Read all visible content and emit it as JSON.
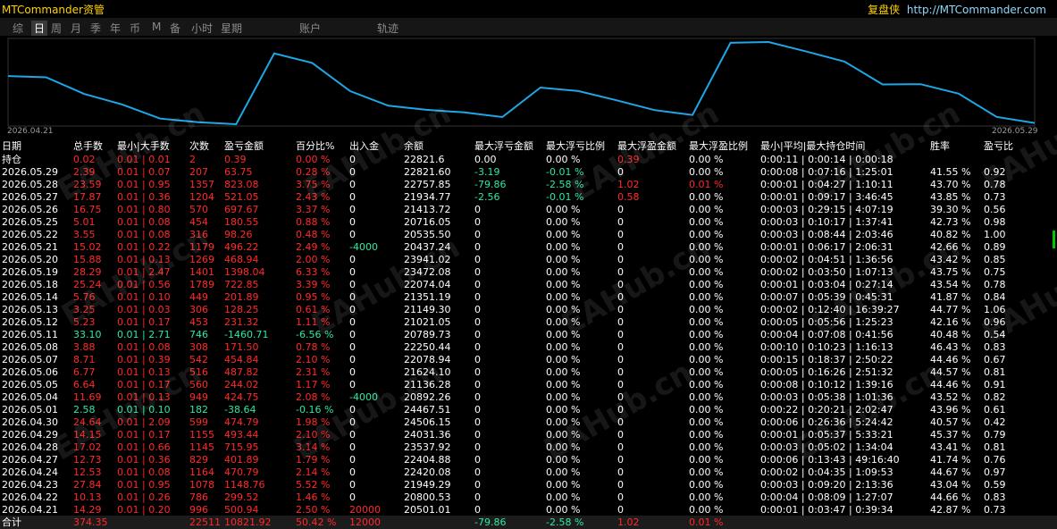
{
  "app": {
    "title": "MTCommander资管",
    "brand_cn": "复盘侠",
    "brand_url": "http://MTCommander.com"
  },
  "tabs": [
    "综",
    "日",
    "周",
    "月",
    "季",
    "年",
    "币",
    "M",
    "备",
    "小时",
    "星期",
    "账户",
    "轨迹"
  ],
  "active_tab": "日",
  "chart_data": {
    "type": "line",
    "x_start_label": "2026.04.21",
    "x_end_label": "2026.05.29",
    "line_color": "#1ea7e6",
    "x": [
      "2026.04.21",
      "2026.04.22",
      "2026.04.23",
      "2026.04.24",
      "2026.04.27",
      "2026.04.28",
      "2026.04.29",
      "2026.04.30",
      "2026.05.01",
      "2026.05.04",
      "2026.05.05",
      "2026.05.06",
      "2026.05.07",
      "2026.05.08",
      "2026.05.11",
      "2026.05.12",
      "2026.05.13",
      "2026.05.14",
      "2026.05.18",
      "2026.05.19",
      "2026.05.20",
      "2026.05.21",
      "2026.05.22",
      "2026.05.25",
      "2026.05.26",
      "2026.05.27",
      "2026.05.28",
      "2026.05.29"
    ],
    "values": [
      20501.01,
      20800.53,
      21949.29,
      22420.08,
      22404.88,
      23537.92,
      24031.36,
      24506.15,
      24467.51,
      20892.26,
      21136.28,
      21624.1,
      22078.94,
      22250.44,
      20789.73,
      21021.05,
      21149.3,
      21351.19,
      22074.04,
      23472.08,
      23941.02,
      20437.24,
      20535.5,
      20716.05,
      21413.72,
      21934.77,
      22757.85,
      22821.6
    ]
  },
  "columns": [
    "日期",
    "总手数",
    "最小|大手数",
    "次数",
    "盈亏金额",
    "百分比%",
    "出入金",
    "余额",
    "最大浮亏金额",
    "最大浮亏比例",
    "最大浮盈金额",
    "最大浮盈比例",
    "最小|平均|最大持仓时间",
    "胜率",
    "盈亏比"
  ],
  "position_row": {
    "date": "持仓",
    "lots": "0.02",
    "minmax": "0.01 | 0.01",
    "count": "2",
    "pnl": "0.39",
    "pct": "0.00 %",
    "flow": "0",
    "balance": "22821.6",
    "max_fl": "0.00",
    "max_flp": "0.00 %",
    "max_fp": "0.39",
    "max_fpp": "0.00 %",
    "hold": "0:00:11 | 0:00:14 | 0:00:18",
    "win": "",
    "ratio": ""
  },
  "rows": [
    {
      "date": "2026.05.29",
      "lots": "2.39",
      "minmax": "0.01 | 0.07",
      "count": "207",
      "pnl": "63.75",
      "pct": "0.28 %",
      "flow": "0",
      "balance": "22821.60",
      "max_fl": "-3.19",
      "max_flp": "-0.01 %",
      "max_fp": "0",
      "max_fpp": "0.00 %",
      "hold": "0:00:08 | 0:07:16 | 1:25:01",
      "win": "41.55 %",
      "ratio": "0.92",
      "c": "red"
    },
    {
      "date": "2026.05.28",
      "lots": "23.59",
      "minmax": "0.01 | 0.95",
      "count": "1357",
      "pnl": "823.08",
      "pct": "3.75 %",
      "flow": "0",
      "balance": "22757.85",
      "max_fl": "-79.86",
      "max_flp": "-2.58 %",
      "max_fp": "1.02",
      "max_fpp": "0.01 %",
      "hold": "0:00:01 | 0:04:27 | 1:10:11",
      "win": "43.70 %",
      "ratio": "0.78",
      "c": "red"
    },
    {
      "date": "2026.05.27",
      "lots": "17.87",
      "minmax": "0.01 | 0.36",
      "count": "1204",
      "pnl": "521.05",
      "pct": "2.43 %",
      "flow": "0",
      "balance": "21934.77",
      "max_fl": "-2.56",
      "max_flp": "-0.01 %",
      "max_fp": "0.58",
      "max_fpp": "0.00 %",
      "hold": "0:00:01 | 0:09:17 | 3:46:45",
      "win": "43.85 %",
      "ratio": "0.73",
      "c": "red"
    },
    {
      "date": "2026.05.26",
      "lots": "16.75",
      "minmax": "0.01 | 0.80",
      "count": "570",
      "pnl": "697.67",
      "pct": "3.37 %",
      "flow": "0",
      "balance": "21413.72",
      "max_fl": "0",
      "max_flp": "0.00 %",
      "max_fp": "0",
      "max_fpp": "0.00 %",
      "hold": "0:00:03 | 0:29:15 | 4:07:19",
      "win": "39.30 %",
      "ratio": "0.56",
      "c": "red"
    },
    {
      "date": "2026.05.25",
      "lots": "5.01",
      "minmax": "0.01 | 0.08",
      "count": "454",
      "pnl": "180.55",
      "pct": "0.88 %",
      "flow": "0",
      "balance": "20716.05",
      "max_fl": "0",
      "max_flp": "0.00 %",
      "max_fp": "0",
      "max_fpp": "0.00 %",
      "hold": "0:00:03 | 0:10:17 | 1:37:41",
      "win": "42.73 %",
      "ratio": "0.98",
      "c": "red"
    },
    {
      "date": "2026.05.22",
      "lots": "3.55",
      "minmax": "0.01 | 0.08",
      "count": "316",
      "pnl": "98.26",
      "pct": "0.48 %",
      "flow": "0",
      "balance": "20535.50",
      "max_fl": "0",
      "max_flp": "0.00 %",
      "max_fp": "0",
      "max_fpp": "0.00 %",
      "hold": "0:00:03 | 0:08:44 | 2:03:46",
      "win": "40.82 %",
      "ratio": "1.00",
      "c": "red"
    },
    {
      "date": "2026.05.21",
      "lots": "15.02",
      "minmax": "0.01 | 0.22",
      "count": "1179",
      "pnl": "496.22",
      "pct": "2.49 %",
      "flow": "-4000",
      "balance": "20437.24",
      "max_fl": "0",
      "max_flp": "0.00 %",
      "max_fp": "0",
      "max_fpp": "0.00 %",
      "hold": "0:00:01 | 0:06:17 | 2:06:31",
      "win": "42.66 %",
      "ratio": "0.89",
      "c": "red"
    },
    {
      "date": "2026.05.20",
      "lots": "15.88",
      "minmax": "0.01 | 0.13",
      "count": "1269",
      "pnl": "468.94",
      "pct": "2.00 %",
      "flow": "0",
      "balance": "23941.02",
      "max_fl": "0",
      "max_flp": "0.00 %",
      "max_fp": "0",
      "max_fpp": "0.00 %",
      "hold": "0:00:02 | 0:04:51 | 1:36:56",
      "win": "43.42 %",
      "ratio": "0.85",
      "c": "red"
    },
    {
      "date": "2026.05.19",
      "lots": "28.29",
      "minmax": "0.01 | 2.47",
      "count": "1401",
      "pnl": "1398.04",
      "pct": "6.33 %",
      "flow": "0",
      "balance": "23472.08",
      "max_fl": "0",
      "max_flp": "0.00 %",
      "max_fp": "0",
      "max_fpp": "0.00 %",
      "hold": "0:00:02 | 0:03:50 | 1:07:13",
      "win": "43.75 %",
      "ratio": "0.75",
      "c": "red"
    },
    {
      "date": "2026.05.18",
      "lots": "25.24",
      "minmax": "0.01 | 0.56",
      "count": "1789",
      "pnl": "722.85",
      "pct": "3.39 %",
      "flow": "0",
      "balance": "22074.04",
      "max_fl": "0",
      "max_flp": "0.00 %",
      "max_fp": "0",
      "max_fpp": "0.00 %",
      "hold": "0:00:01 | 0:03:04 | 0:27:14",
      "win": "43.54 %",
      "ratio": "0.78",
      "c": "red"
    },
    {
      "date": "2026.05.14",
      "lots": "5.76",
      "minmax": "0.01 | 0.10",
      "count": "449",
      "pnl": "201.89",
      "pct": "0.95 %",
      "flow": "0",
      "balance": "21351.19",
      "max_fl": "0",
      "max_flp": "0.00 %",
      "max_fp": "0",
      "max_fpp": "0.00 %",
      "hold": "0:00:07 | 0:05:39 | 0:45:31",
      "win": "41.87 %",
      "ratio": "0.84",
      "c": "red"
    },
    {
      "date": "2026.05.13",
      "lots": "3.25",
      "minmax": "0.01 | 0.03",
      "count": "306",
      "pnl": "128.25",
      "pct": "0.61 %",
      "flow": "0",
      "balance": "21149.30",
      "max_fl": "0",
      "max_flp": "0.00 %",
      "max_fp": "0",
      "max_fpp": "0.00 %",
      "hold": "0:00:02 | 0:12:40 | 16:39:27",
      "win": "44.77 %",
      "ratio": "1.06",
      "c": "red"
    },
    {
      "date": "2026.05.12",
      "lots": "5.23",
      "minmax": "0.01 | 0.17",
      "count": "453",
      "pnl": "231.32",
      "pct": "1.11 %",
      "flow": "0",
      "balance": "21021.05",
      "max_fl": "0",
      "max_flp": "0.00 %",
      "max_fp": "0",
      "max_fpp": "0.00 %",
      "hold": "0:00:05 | 0:05:56 | 1:25:23",
      "win": "42.16 %",
      "ratio": "0.96",
      "c": "red"
    },
    {
      "date": "2026.05.11",
      "lots": "33.10",
      "minmax": "0.01 | 2.71",
      "count": "746",
      "pnl": "-1460.71",
      "pct": "-6.56 %",
      "flow": "0",
      "balance": "20789.73",
      "max_fl": "0",
      "max_flp": "0.00 %",
      "max_fp": "0",
      "max_fpp": "0.00 %",
      "hold": "0:00:04 | 0:07:08 | 0:41:56",
      "win": "40.48 %",
      "ratio": "0.54",
      "c": "green"
    },
    {
      "date": "2026.05.08",
      "lots": "3.88",
      "minmax": "0.01 | 0.08",
      "count": "308",
      "pnl": "171.50",
      "pct": "0.78 %",
      "flow": "0",
      "balance": "22250.44",
      "max_fl": "0",
      "max_flp": "0.00 %",
      "max_fp": "0",
      "max_fpp": "0.00 %",
      "hold": "0:00:10 | 0:10:23 | 1:16:13",
      "win": "46.43 %",
      "ratio": "0.83",
      "c": "red"
    },
    {
      "date": "2026.05.07",
      "lots": "8.71",
      "minmax": "0.01 | 0.39",
      "count": "542",
      "pnl": "454.84",
      "pct": "2.10 %",
      "flow": "0",
      "balance": "22078.94",
      "max_fl": "0",
      "max_flp": "0.00 %",
      "max_fp": "0",
      "max_fpp": "0.00 %",
      "hold": "0:00:15 | 0:18:37 | 2:50:22",
      "win": "44.46 %",
      "ratio": "0.67",
      "c": "red"
    },
    {
      "date": "2026.05.06",
      "lots": "6.77",
      "minmax": "0.01 | 0.13",
      "count": "516",
      "pnl": "487.82",
      "pct": "2.31 %",
      "flow": "0",
      "balance": "21624.10",
      "max_fl": "0",
      "max_flp": "0.00 %",
      "max_fp": "0",
      "max_fpp": "0.00 %",
      "hold": "0:00:05 | 0:16:26 | 2:51:32",
      "win": "44.57 %",
      "ratio": "0.81",
      "c": "red"
    },
    {
      "date": "2026.05.05",
      "lots": "6.64",
      "minmax": "0.01 | 0.17",
      "count": "560",
      "pnl": "244.02",
      "pct": "1.17 %",
      "flow": "0",
      "balance": "21136.28",
      "max_fl": "0",
      "max_flp": "0.00 %",
      "max_fp": "0",
      "max_fpp": "0.00 %",
      "hold": "0:00:08 | 0:10:12 | 1:39:16",
      "win": "44.46 %",
      "ratio": "0.91",
      "c": "red"
    },
    {
      "date": "2026.05.04",
      "lots": "11.69",
      "minmax": "0.01 | 0.13",
      "count": "949",
      "pnl": "424.75",
      "pct": "2.08 %",
      "flow": "-4000",
      "balance": "20892.26",
      "max_fl": "0",
      "max_flp": "0.00 %",
      "max_fp": "0",
      "max_fpp": "0.00 %",
      "hold": "0:00:03 | 0:05:38 | 1:01:36",
      "win": "43.52 %",
      "ratio": "0.82",
      "c": "red"
    },
    {
      "date": "2026.05.01",
      "lots": "2.58",
      "minmax": "0.01 | 0.10",
      "count": "182",
      "pnl": "-38.64",
      "pct": "-0.16 %",
      "flow": "0",
      "balance": "24467.51",
      "max_fl": "0",
      "max_flp": "0.00 %",
      "max_fp": "0",
      "max_fpp": "0.00 %",
      "hold": "0:00:22 | 0:20:21 | 2:02:47",
      "win": "43.96 %",
      "ratio": "0.61",
      "c": "green"
    },
    {
      "date": "2026.04.30",
      "lots": "24.64",
      "minmax": "0.01 | 2.09",
      "count": "599",
      "pnl": "474.79",
      "pct": "1.98 %",
      "flow": "0",
      "balance": "24506.15",
      "max_fl": "0",
      "max_flp": "0.00 %",
      "max_fp": "0",
      "max_fpp": "0.00 %",
      "hold": "0:00:06 | 0:26:36 | 5:24:42",
      "win": "40.57 %",
      "ratio": "0.42",
      "c": "red"
    },
    {
      "date": "2026.04.29",
      "lots": "14.15",
      "minmax": "0.01 | 0.17",
      "count": "1155",
      "pnl": "493.44",
      "pct": "2.10 %",
      "flow": "0",
      "balance": "24031.36",
      "max_fl": "0",
      "max_flp": "0.00 %",
      "max_fp": "0",
      "max_fpp": "0.00 %",
      "hold": "0:00:01 | 0:05:37 | 5:33:21",
      "win": "45.37 %",
      "ratio": "0.79",
      "c": "red"
    },
    {
      "date": "2026.04.28",
      "lots": "17.02",
      "minmax": "0.01 | 0.66",
      "count": "1145",
      "pnl": "715.95",
      "pct": "3.14 %",
      "flow": "0",
      "balance": "23537.92",
      "max_fl": "0",
      "max_flp": "0.00 %",
      "max_fp": "0",
      "max_fpp": "0.00 %",
      "hold": "0:00:03 | 0:05:02 | 1:34:04",
      "win": "43.41 %",
      "ratio": "0.81",
      "c": "red"
    },
    {
      "date": "2026.04.27",
      "lots": "12.73",
      "minmax": "0.01 | 0.36",
      "count": "829",
      "pnl": "401.89",
      "pct": "1.79 %",
      "flow": "0",
      "balance": "22404.88",
      "max_fl": "0",
      "max_flp": "0.00 %",
      "max_fp": "0",
      "max_fpp": "0.00 %",
      "hold": "0:00:06 | 0:13:43 | 49:16:40",
      "win": "41.74 %",
      "ratio": "0.76",
      "c": "red"
    },
    {
      "date": "2026.04.24",
      "lots": "12.53",
      "minmax": "0.01 | 0.08",
      "count": "1164",
      "pnl": "470.79",
      "pct": "2.14 %",
      "flow": "0",
      "balance": "22420.08",
      "max_fl": "0",
      "max_flp": "0.00 %",
      "max_fp": "0",
      "max_fpp": "0.00 %",
      "hold": "0:00:02 | 0:04:35 | 1:09:53",
      "win": "44.67 %",
      "ratio": "0.97",
      "c": "red"
    },
    {
      "date": "2026.04.23",
      "lots": "27.84",
      "minmax": "0.01 | 0.95",
      "count": "1078",
      "pnl": "1148.76",
      "pct": "5.52 %",
      "flow": "0",
      "balance": "21949.29",
      "max_fl": "0",
      "max_flp": "0.00 %",
      "max_fp": "0",
      "max_fpp": "0.00 %",
      "hold": "0:00:03 | 0:09:20 | 2:13:36",
      "win": "43.04 %",
      "ratio": "0.59",
      "c": "red"
    },
    {
      "date": "2026.04.22",
      "lots": "10.13",
      "minmax": "0.01 | 0.26",
      "count": "786",
      "pnl": "299.52",
      "pct": "1.46 %",
      "flow": "0",
      "balance": "20800.53",
      "max_fl": "0",
      "max_flp": "0.00 %",
      "max_fp": "0",
      "max_fpp": "0.00 %",
      "hold": "0:00:04 | 0:08:09 | 1:27:07",
      "win": "44.66 %",
      "ratio": "0.83",
      "c": "red"
    },
    {
      "date": "2026.04.21",
      "lots": "14.29",
      "minmax": "0.01 | 0.20",
      "count": "996",
      "pnl": "500.94",
      "pct": "2.50 %",
      "flow": "20000",
      "balance": "20501.01",
      "max_fl": "0",
      "max_flp": "0.00 %",
      "max_fp": "0",
      "max_fpp": "0.00 %",
      "hold": "0:00:01 | 0:03:47 | 0:39:34",
      "win": "42.87 %",
      "ratio": "0.73",
      "c": "red"
    }
  ],
  "total_row": {
    "date": "合计",
    "lots": "374.35",
    "minmax": "",
    "count": "22511",
    "pnl": "10821.92",
    "pct": "50.42 %",
    "flow": "12000",
    "balance": "",
    "max_fl": "-79.86",
    "max_flp": "-2.58 %",
    "max_fp": "1.02",
    "max_fpp": "0.01 %",
    "hold": "",
    "win": "",
    "ratio": ""
  },
  "watermark": "EAHub.cn"
}
